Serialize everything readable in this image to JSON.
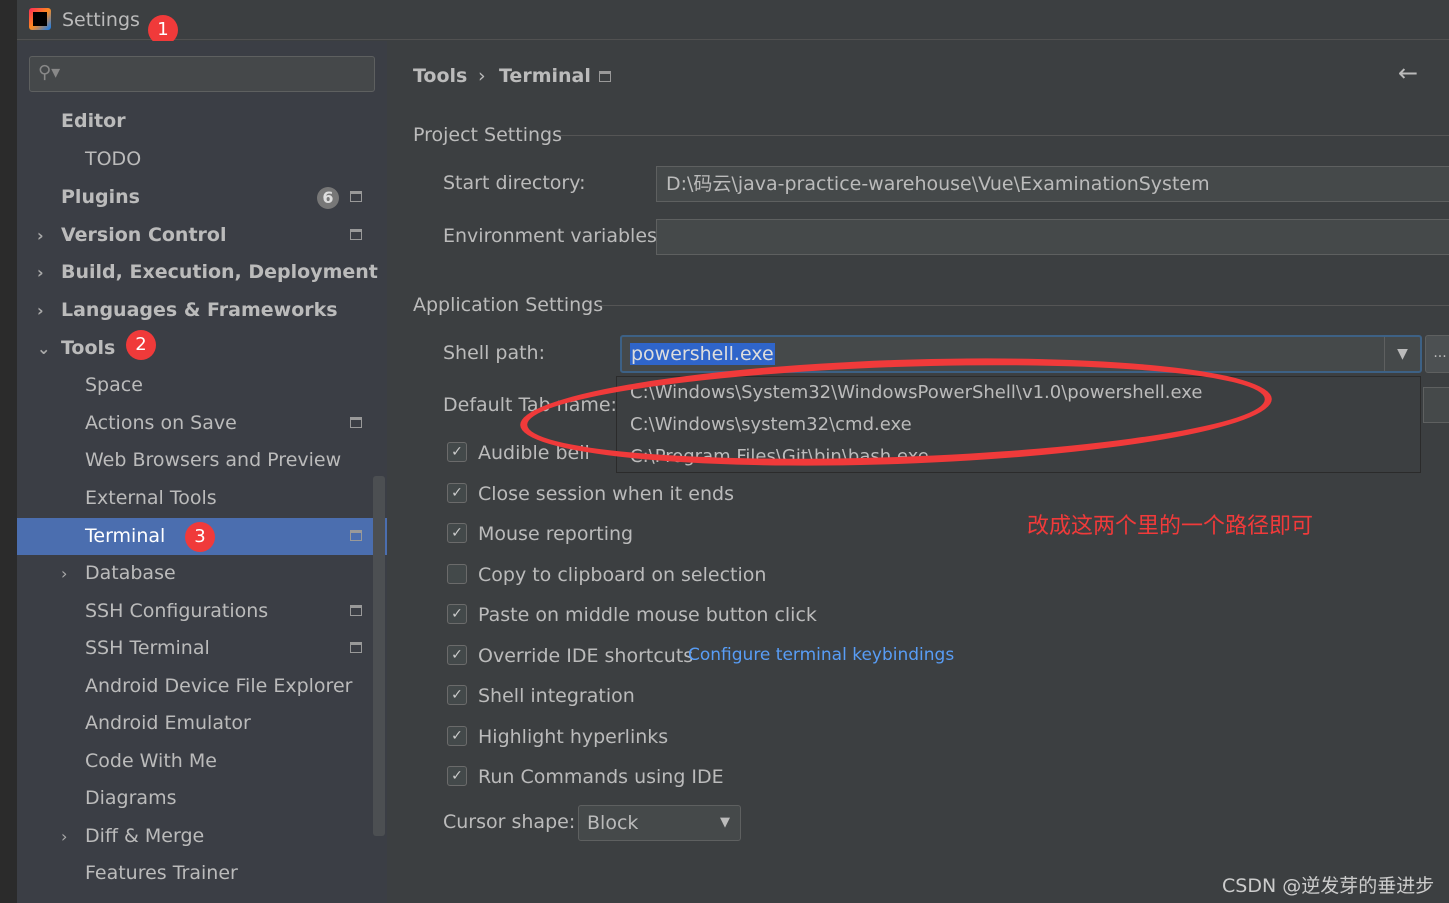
{
  "window": {
    "title": "Settings"
  },
  "badges": [
    "1",
    "2",
    "3"
  ],
  "sidebar": {
    "search_placeholder": "",
    "items": [
      {
        "label": "Editor",
        "bold": true
      },
      {
        "label": "TODO"
      },
      {
        "label": "Plugins",
        "bold": true,
        "count": "6"
      },
      {
        "label": "Version Control",
        "bold": true
      },
      {
        "label": "Build, Execution, Deployment",
        "bold": true
      },
      {
        "label": "Languages & Frameworks",
        "bold": true
      },
      {
        "label": "Tools",
        "bold": true
      },
      {
        "label": "Space"
      },
      {
        "label": "Actions on Save"
      },
      {
        "label": "Web Browsers and Preview"
      },
      {
        "label": "External Tools"
      },
      {
        "label": "Terminal"
      },
      {
        "label": "Database"
      },
      {
        "label": "SSH Configurations"
      },
      {
        "label": "SSH Terminal"
      },
      {
        "label": "Android Device File Explorer"
      },
      {
        "label": "Android Emulator"
      },
      {
        "label": "Code With Me"
      },
      {
        "label": "Diagrams"
      },
      {
        "label": "Diff & Merge"
      },
      {
        "label": "Features Trainer"
      }
    ]
  },
  "breadcrumb": {
    "parent": "Tools",
    "current": "Terminal"
  },
  "project_settings": {
    "title": "Project Settings",
    "start_dir_label": "Start directory:",
    "start_dir_value": "D:\\码云\\java-practice-warehouse\\Vue\\ExaminationSystem",
    "env_label": "Environment variables:",
    "env_value": ""
  },
  "app_settings": {
    "title": "Application Settings",
    "shell_label": "Shell path:",
    "shell_value": "powershell.exe",
    "shell_options": [
      "C:\\Windows\\System32\\WindowsPowerShell\\v1.0\\powershell.exe",
      "C:\\Windows\\system32\\cmd.exe",
      "C:\\Program Files\\Git\\bin\\bash.exe"
    ],
    "tab_label": "Default Tab name:",
    "checkboxes": [
      {
        "label": "Audible bell",
        "checked": true
      },
      {
        "label": "Close session when it ends",
        "checked": true
      },
      {
        "label": "Mouse reporting",
        "checked": true
      },
      {
        "label": "Copy to clipboard on selection",
        "checked": false
      },
      {
        "label": "Paste on middle mouse button click",
        "checked": true
      },
      {
        "label": "Override IDE shortcuts",
        "checked": true
      },
      {
        "label": "Shell integration",
        "checked": true
      },
      {
        "label": "Highlight hyperlinks",
        "checked": true
      },
      {
        "label": "Run Commands using IDE",
        "checked": true
      }
    ],
    "keybindings_link": "Configure terminal keybindings",
    "cursor_label": "Cursor shape:",
    "cursor_value": "Block"
  },
  "annotation": "改成这两个里的一个路径即可",
  "watermark": "CSDN @逆发芽的垂进步",
  "colors": {
    "selection": "#4b6eaf",
    "annotation": "#f03a3a",
    "link": "#589df6"
  }
}
